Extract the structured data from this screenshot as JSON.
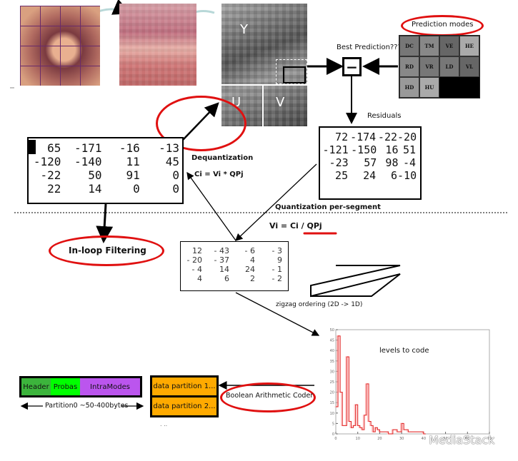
{
  "prediction": {
    "title": "Prediction modes",
    "best": "Best Prediction???",
    "modes": [
      "DC",
      "TM",
      "VE",
      "HE",
      "RD",
      "VR",
      "LD",
      "VL",
      "HD",
      "HU"
    ],
    "operator": "−"
  },
  "planes": {
    "y": "Y",
    "u": "U",
    "v": "V"
  },
  "residuals": {
    "label": "Residuals",
    "matrix": [
      [
        72,
        -174,
        -22,
        -20
      ],
      [
        -121,
        -150,
        16,
        51
      ],
      [
        -23,
        57,
        98,
        -4
      ],
      [
        25,
        24,
        6,
        -10
      ]
    ]
  },
  "dequant": {
    "title": "Dequantization",
    "formula": "Ci = Vi * QPj",
    "matrix": [
      [
        65,
        -171,
        -16,
        -13
      ],
      [
        -120,
        -140,
        11,
        45
      ],
      [
        -22,
        50,
        91,
        0
      ],
      [
        22,
        14,
        0,
        0
      ]
    ]
  },
  "quant": {
    "title": "Quantization per-segment",
    "formula_prefix": "Vi = Ci / ",
    "formula_emph": "QPj",
    "matrix": [
      [
        "12",
        "- 43",
        "- 6",
        "- 3"
      ],
      [
        "- 20",
        "- 37",
        "4",
        "9"
      ],
      [
        "- 4",
        "14",
        "24",
        "- 1"
      ],
      [
        "4",
        "6",
        "2",
        "- 2"
      ]
    ]
  },
  "zigzag": {
    "label": "zigzag ordering  (2D -> 1D)"
  },
  "filter": {
    "label": "In-loop Filtering"
  },
  "bitstream": {
    "header": "Header",
    "probas": "Probas",
    "intramodes": "IntraModes",
    "partition0": "Partition0 ~50-400bytes",
    "data1": "data partition 1...",
    "data2": "data partition 2...",
    "ellipsis": ". ..",
    "coder": "Boolean Arithmetic Coder",
    "colors": {
      "header": "#3cb43c",
      "probas": "#00ff00",
      "intramodes": "#bb55ee",
      "data": "#ffaa00",
      "highlight": "#e01010"
    }
  },
  "watermark": "MediaStack",
  "chart_data": {
    "type": "line",
    "annotation": "levels to code",
    "xlim": [
      0,
      70
    ],
    "ylim": [
      0,
      50
    ],
    "xticks": [
      0,
      10,
      20,
      30,
      40,
      50,
      60,
      70
    ],
    "yticks": [
      0,
      5,
      10,
      15,
      20,
      25,
      30,
      35,
      40,
      45,
      50
    ],
    "series": [
      {
        "color": "#e02020",
        "x": [
          0,
          1,
          2,
          3,
          4,
          5,
          6,
          7,
          8,
          9,
          10,
          11,
          12,
          13,
          14,
          15,
          16,
          17,
          18,
          19,
          20,
          24,
          26,
          28,
          30,
          31,
          33,
          35,
          40
        ],
        "y": [
          13,
          47,
          20,
          4,
          4,
          37,
          6,
          3,
          4,
          14,
          4,
          3,
          2,
          9,
          24,
          6,
          4,
          1,
          3,
          2,
          1,
          0,
          2,
          1,
          5,
          2,
          1,
          1,
          0
        ]
      }
    ]
  }
}
